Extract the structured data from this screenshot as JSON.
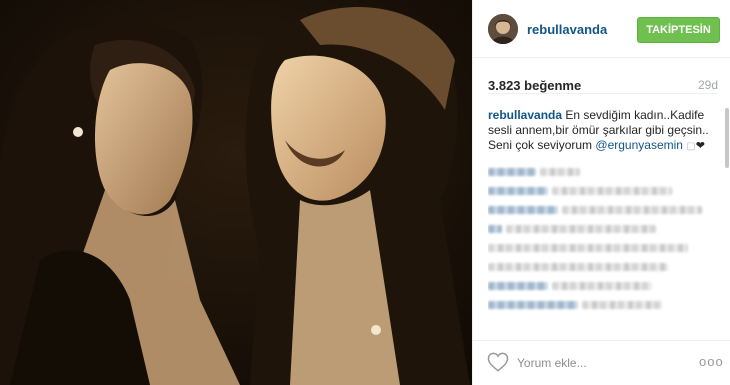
{
  "post": {
    "image_alt": "sepia photo of two women singing",
    "colors": {
      "photo_shadow": "#1a1208",
      "photo_mid": "#7a5a38",
      "photo_light": "#d9b48a"
    }
  },
  "header": {
    "username": "rebullavanda",
    "follow_label": "TAKİPTESİN",
    "follow_color": "#70c050"
  },
  "meta": {
    "likes": "3.823 beğenme",
    "time": "29d"
  },
  "caption": {
    "username": "rebullavanda",
    "text": "En sevdiğim kadın..Kadife sesli annem,bir ömür şarkılar gibi geçsin..",
    "line2": "Seni çok seviyorum",
    "mention": "@ergunyasemin",
    "emoji_box": "▢",
    "heart": "❤"
  },
  "footer": {
    "comment_placeholder": "Yorum ekle...",
    "more": "ooo"
  },
  "colors": {
    "link": "#125688",
    "text": "#262626",
    "muted": "#a5a7aa"
  },
  "icons": {
    "like": "heart-outline-icon",
    "more": "more-options-icon"
  }
}
